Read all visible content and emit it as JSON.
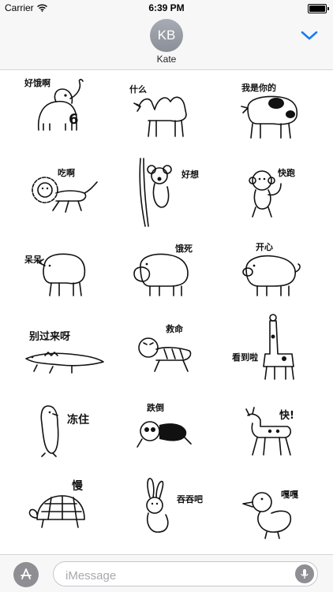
{
  "status": {
    "carrier": "Carrier",
    "time": "6:39 PM",
    "battery_level": 1.0
  },
  "header": {
    "avatar_initials": "KB",
    "contact_name": "Kate",
    "chevron": "chevron-down-icon",
    "accent": "#1a7cf2"
  },
  "stickers": [
    {
      "animal": "elephant",
      "caption": "好饿啊"
    },
    {
      "animal": "camel",
      "caption": "什么"
    },
    {
      "animal": "cow",
      "caption": "我是你的"
    },
    {
      "animal": "lion",
      "caption": "吃啊"
    },
    {
      "animal": "koala",
      "caption": "好想"
    },
    {
      "animal": "monkey",
      "caption": "快跑"
    },
    {
      "animal": "rhino",
      "caption": "呆呆"
    },
    {
      "animal": "hippo",
      "caption": "饿死"
    },
    {
      "animal": "pig",
      "caption": "开心"
    },
    {
      "animal": "crocodile",
      "caption": "别过来呀"
    },
    {
      "animal": "tiger",
      "caption": "救命"
    },
    {
      "animal": "giraffe",
      "caption": "看到啦"
    },
    {
      "animal": "penguin",
      "caption": "冻住"
    },
    {
      "animal": "panda",
      "caption": "跌倒"
    },
    {
      "animal": "deer",
      "caption": "快!"
    },
    {
      "animal": "turtle",
      "caption": "慢"
    },
    {
      "animal": "rabbit",
      "caption": "吞吞吧"
    },
    {
      "animal": "duck",
      "caption": "嘎嘎"
    }
  ],
  "input": {
    "placeholder": "iMessage",
    "value": ""
  },
  "icons": {
    "apps": "app-store-icon",
    "mic": "microphone-icon",
    "wifi": "wifi-icon",
    "battery": "battery-icon"
  }
}
